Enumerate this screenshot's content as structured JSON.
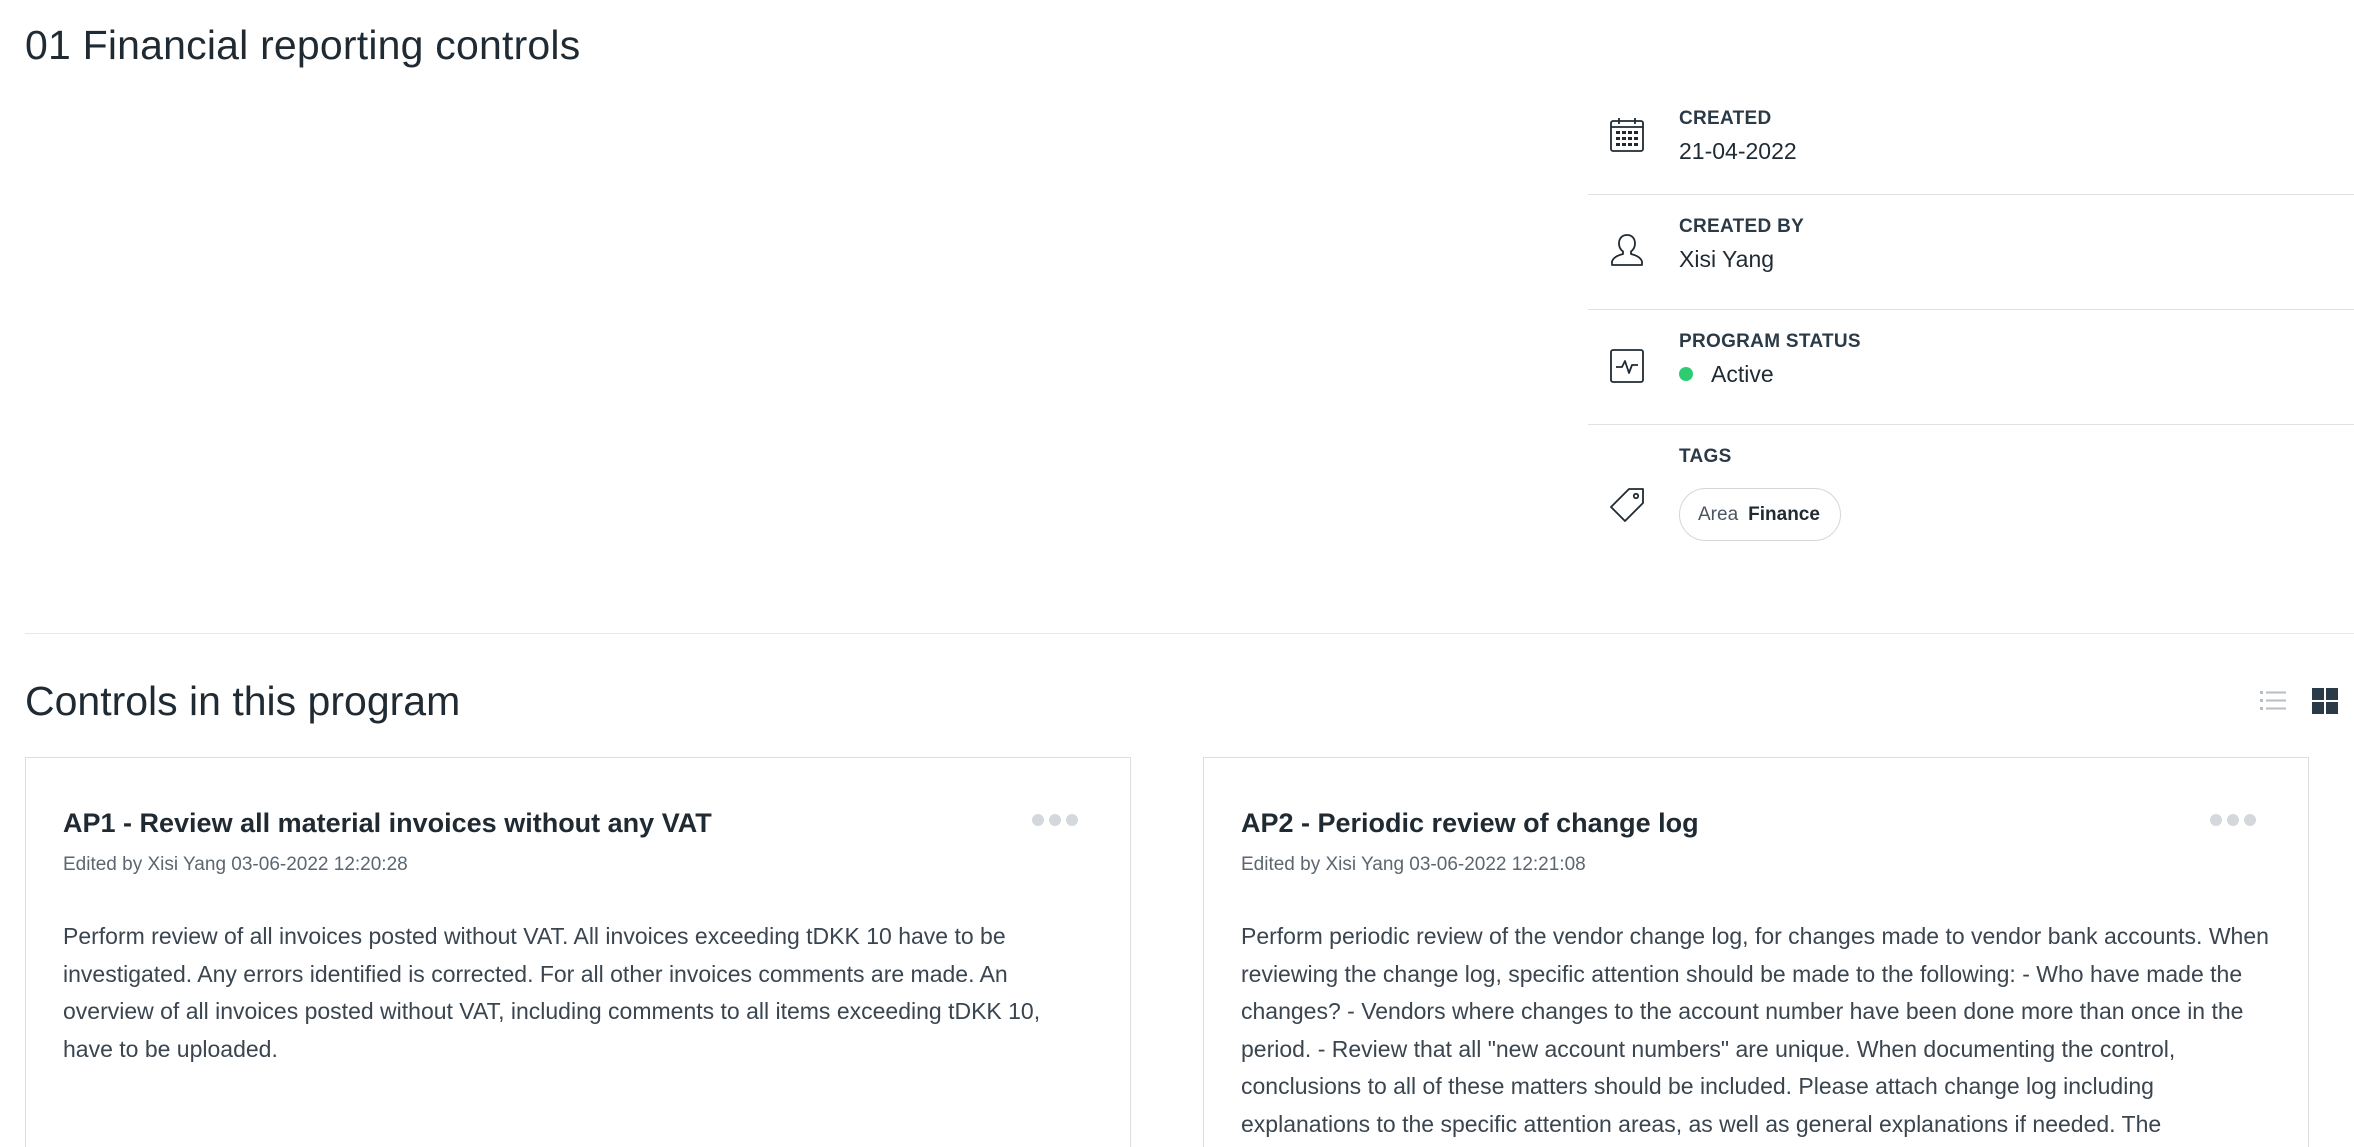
{
  "page": {
    "title": "01 Financial reporting controls"
  },
  "meta": {
    "created": {
      "label": "CREATED",
      "value": "21-04-2022",
      "icon": "calendar-icon"
    },
    "created_by": {
      "label": "CREATED BY",
      "value": "Xisi Yang",
      "icon": "user-icon"
    },
    "program_status": {
      "label": "PROGRAM STATUS",
      "value": "Active",
      "status_color": "#2ecc71",
      "icon": "activity-icon"
    },
    "tags": {
      "label": "TAGS",
      "icon": "tag-icon",
      "items": [
        {
          "key": "Area",
          "value": "Finance"
        }
      ]
    }
  },
  "controls": {
    "title": "Controls in this program",
    "view_toggle": {
      "list_icon": "list-view-icon",
      "grid_icon": "grid-view-icon",
      "active": "grid"
    },
    "cards": [
      {
        "title": "AP1 - Review all material invoices without any VAT",
        "edited": "Edited by Xisi Yang 03-06-2022 12:20:28",
        "description": "Perform review of all invoices posted without VAT. All invoices exceeding tDKK 10 have to be investigated. Any errors identified is corrected. For all other invoices comments are made. An overview of all invoices posted without VAT, including comments to all items exceeding tDKK 10, have to be uploaded.",
        "menu_icon": "more-horizontal-icon"
      },
      {
        "title": "AP2 - Periodic review of change log",
        "edited": "Edited by Xisi Yang 03-06-2022 12:21:08",
        "description": "Perform periodic review of the vendor change log, for changes made to vendor bank accounts. When reviewing the change log, specific attention should be made to the following: - Who have made the changes? - Vendors where changes to the account number have been done more than once in the period. - Review that all \"new account numbers\" are unique. When documenting the control, conclusions to all of these matters should be included. Please attach change log including explanations to the specific attention areas, as well as general explanations if needed. The",
        "menu_icon": "more-horizontal-icon"
      }
    ]
  },
  "colors": {
    "text_primary": "#1f2a33",
    "border": "#dcdfe2",
    "status_active": "#2ecc71",
    "grid_icon_active": "#2b3a47",
    "list_icon_inactive": "#b6bcc2"
  }
}
